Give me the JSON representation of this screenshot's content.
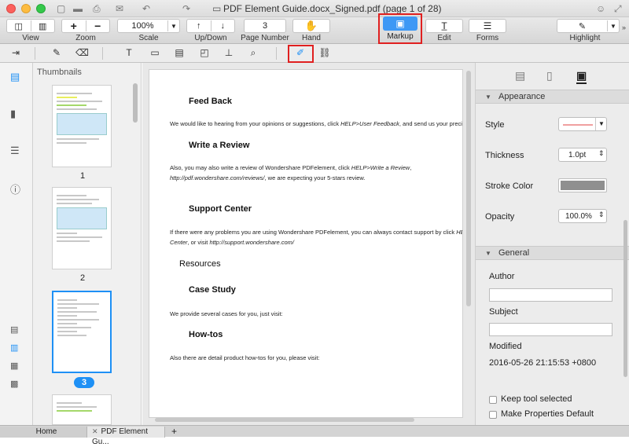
{
  "window": {
    "title": "PDF Element Guide.docx_Signed.pdf (page 1 of 28)"
  },
  "toolbar": {
    "view_label": "View",
    "zoom_label": "Zoom",
    "zoom_in": "+",
    "zoom_out": "−",
    "scale_value": "100%",
    "scale_label": "Scale",
    "updown_label": "Up/Down",
    "page_number_value": "3",
    "page_number_label": "Page Number",
    "hand_label": "Hand",
    "markup_label": "Markup",
    "edit_label": "Edit",
    "forms_label": "Forms",
    "highlight_label": "Highlight"
  },
  "thumbnails": {
    "title": "Thumbnails",
    "pages": [
      {
        "label": "1"
      },
      {
        "label": "2"
      },
      {
        "label": "3",
        "selected": true
      }
    ]
  },
  "document": {
    "blocks": [
      {
        "heading": "Feed Back"
      },
      {
        "paragraph_pre": "We would like to hearing from your opinions or suggestions, click ",
        "paragraph_em": "HELP>User Feedback",
        "paragraph_post": ", and send us your precious fe"
      },
      {
        "heading": "Write a Review"
      },
      {
        "paragraph_pre": "Also,  you  may  also  write  a  review  of  Wondershare  PDFelement,  click  ",
        "paragraph_em": "HELP>Write  a  Review",
        "paragraph_post": ","
      },
      {
        "paragraph_line2_em": "http://pdf.wondershare.com/reviews/",
        "paragraph_line2_post": ", we are expecting your 5-stars review."
      },
      {
        "heading": "Support Center"
      },
      {
        "paragraph_pre": "If there were any problems you are using Wondershare PDFelement, you can always contact support by click ",
        "paragraph_em": "HELP"
      },
      {
        "paragraph_line2_em": "Center",
        "paragraph_line2_post": ", or visit ",
        "paragraph_line2_em2": "http://support.wondershare.com/"
      },
      {
        "heading": "Resources"
      },
      {
        "heading": "Case Study"
      },
      {
        "paragraph_pre": "We provide several cases for you, just visit:"
      },
      {
        "heading": "How-tos"
      },
      {
        "paragraph_pre": "Also there are detail product how-tos for you, please visit:"
      }
    ]
  },
  "properties": {
    "appearance_label": "Appearance",
    "style_label": "Style",
    "thickness_label": "Thickness",
    "thickness_value": "1.0pt",
    "stroke_color_label": "Stroke Color",
    "stroke_color": "#8f8f8f",
    "style_color": "#f0a0a0",
    "opacity_label": "Opacity",
    "opacity_value": "100.0%",
    "general_label": "General",
    "author_label": "Author",
    "author_value": "",
    "subject_label": "Subject",
    "subject_value": "",
    "modified_label": "Modified",
    "modified_value": "2016-05-26 21:15:53 +0800",
    "keep_tool_label": "Keep tool selected",
    "make_default_label": "Make Properties Default"
  },
  "tabs": {
    "home_label": "Home",
    "doc_tab_label": "PDF Element Gu...",
    "add_label": "+"
  },
  "colors": {
    "accent": "#3d98f5",
    "highlight_box": "#e02020"
  }
}
